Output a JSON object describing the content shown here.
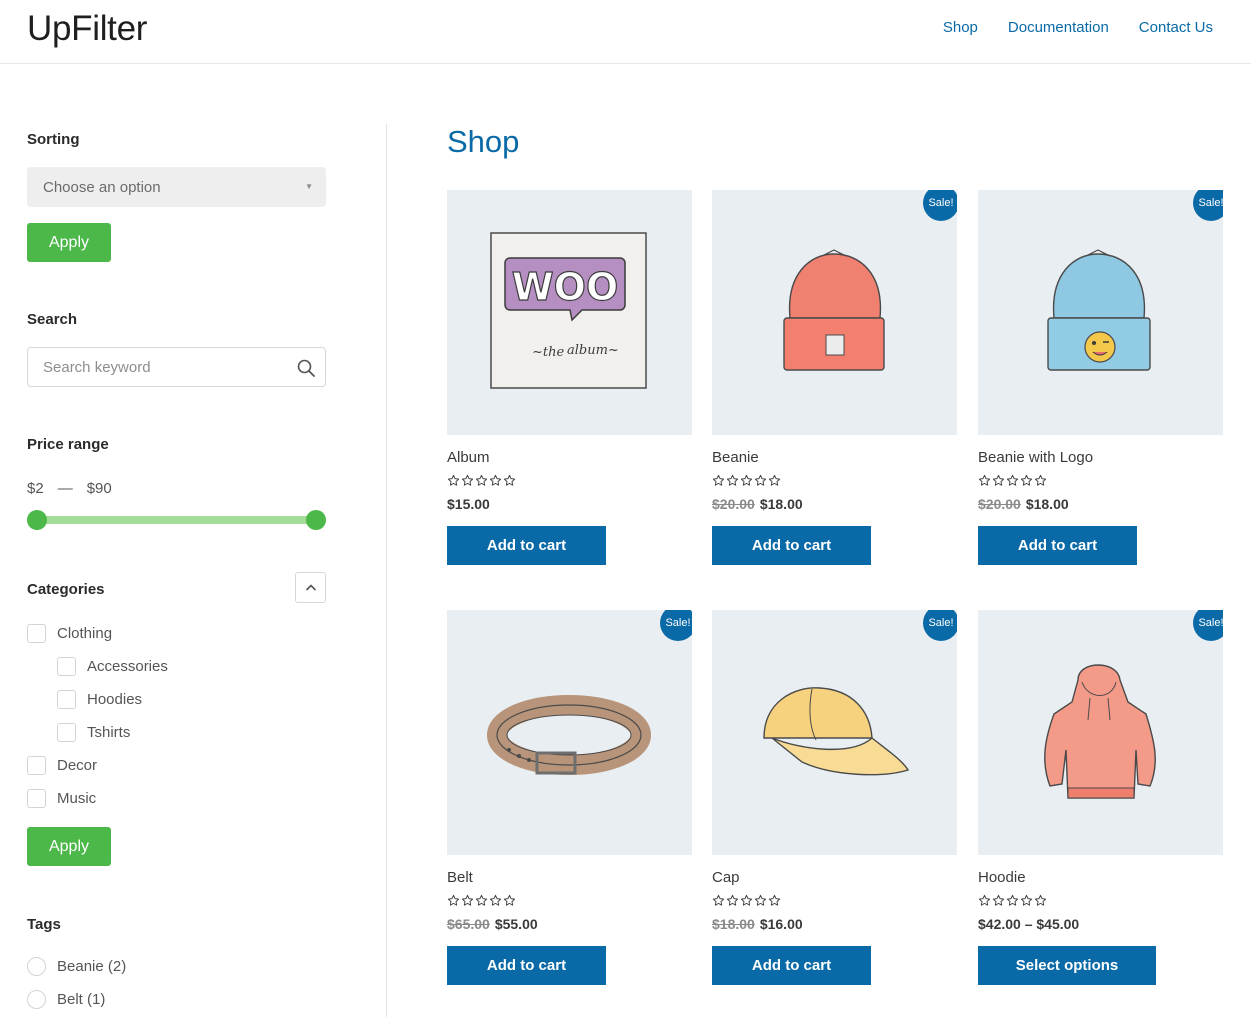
{
  "header": {
    "logo": "UpFilter",
    "nav": [
      "Shop",
      "Documentation",
      "Contact Us"
    ]
  },
  "sidebar": {
    "sorting": {
      "title": "Sorting",
      "selected": "Choose an option",
      "apply_label": "Apply"
    },
    "search": {
      "title": "Search",
      "placeholder": "Search keyword"
    },
    "price": {
      "title": "Price range",
      "min_label": "$2",
      "separator": "—",
      "max_label": "$90",
      "range_min": 2,
      "range_max": 90,
      "selected_min": 2,
      "selected_max": 90
    },
    "categories": {
      "title": "Categories",
      "items": [
        {
          "label": "Clothing",
          "level": 0
        },
        {
          "label": "Accessories",
          "level": 1
        },
        {
          "label": "Hoodies",
          "level": 1
        },
        {
          "label": "Tshirts",
          "level": 1
        },
        {
          "label": "Decor",
          "level": 0
        },
        {
          "label": "Music",
          "level": 0
        }
      ],
      "apply_label": "Apply"
    },
    "tags": {
      "title": "Tags",
      "items": [
        "Beanie (2)",
        "Belt (1)"
      ]
    }
  },
  "main": {
    "title": "Shop",
    "sale_label": "Sale!",
    "products": [
      {
        "name": "Album",
        "old_price": "",
        "price": "$15.00",
        "button": "Add to cart",
        "sale": false,
        "image": "album-icon"
      },
      {
        "name": "Beanie",
        "old_price": "$20.00",
        "price": "$18.00",
        "button": "Add to cart",
        "sale": true,
        "image": "beanie-icon"
      },
      {
        "name": "Beanie with Logo",
        "old_price": "$20.00",
        "price": "$18.00",
        "button": "Add to cart",
        "sale": true,
        "image": "beanie-logo-icon"
      },
      {
        "name": "Belt",
        "old_price": "$65.00",
        "price": "$55.00",
        "button": "Add to cart",
        "sale": true,
        "image": "belt-icon"
      },
      {
        "name": "Cap",
        "old_price": "$18.00",
        "price": "$16.00",
        "button": "Add to cart",
        "sale": true,
        "image": "cap-icon"
      },
      {
        "name": "Hoodie",
        "old_price": "",
        "price": "$42.00 – $45.00",
        "button": "Select options",
        "sale": true,
        "image": "hoodie-icon"
      }
    ]
  },
  "colors": {
    "brand_blue": "#0a6aa7",
    "apply_green": "#4cb849",
    "slider_track": "#a4dc9a"
  }
}
